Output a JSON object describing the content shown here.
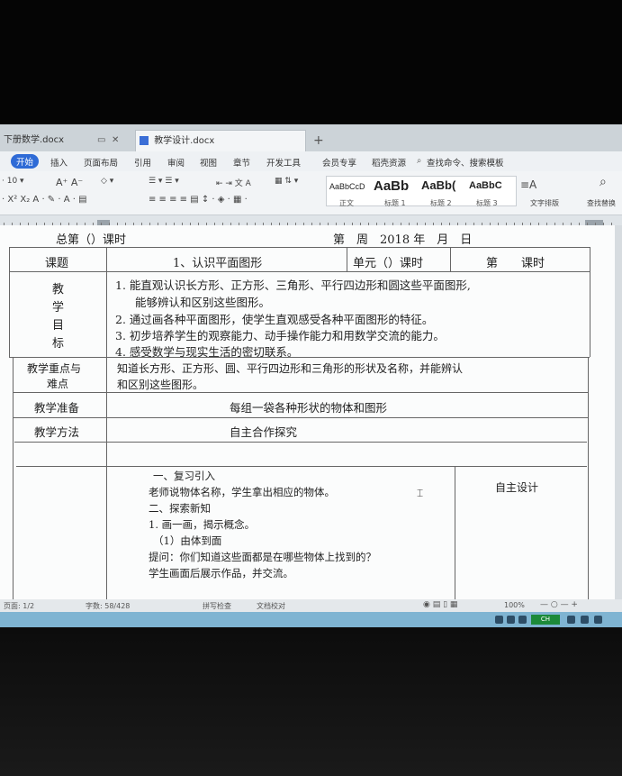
{
  "tabs": {
    "doc1": "下册数学.docx",
    "doc2": "教学设计.docx",
    "add": "+"
  },
  "menu": {
    "start": "开始",
    "insert": "插入",
    "layout": "页面布局",
    "reference": "引用",
    "review": "审阅",
    "view": "视图",
    "section": "章节",
    "dev": "开发工具",
    "vip": "会员专享",
    "resources": "稻壳资源",
    "search": "查找命令、搜索模板"
  },
  "ribbon": {
    "font_size": "10",
    "style1_sample": "AaBbCcD",
    "style1_label": "正文",
    "style2_sample": "AaBb",
    "style2_label": "标题 1",
    "style3_sample": "AaBb(",
    "style3_label": "标题 2",
    "style4_sample": "AaBbC",
    "style4_label": "标题 3",
    "text_layout": "文字排版",
    "find_replace": "查找替换"
  },
  "doc": {
    "header_left": "总第（）课时",
    "header_right": "第　周　2018 年　月　日",
    "row1": {
      "label": "课题",
      "title": "1、认识平面图形",
      "unit": "单元（）课时",
      "period": "第　　课时"
    },
    "goals_label": "教\n学\n目\n标",
    "goals": [
      "1. 能直观认识长方形、正方形、三角形、平行四边形和圆这些平面图形,",
      "能够辨认和区别这些图形。",
      "2. 通过画各种平面图形，使学生直观感受各种平面图形的特征。",
      "3. 初步培养学生的观察能力、动手操作能力和用数学交流的能力。",
      "4. 感受数学与现实生活的密切联系。"
    ],
    "key_label_1": "教学重点与",
    "key_label_2": "难点",
    "key_text_1": "知道长方形、正方形、圆、平行四边形和三角形的形状及名称，并能辨认",
    "key_text_2": "和区别这些图形。",
    "prep_label": "教学准备",
    "prep_text": "每组一袋各种形状的物体和图形",
    "method_label": "教学方法",
    "method_text": "自主合作探究",
    "process": [
      "一、复习引入",
      "老师说物体名称，学生拿出相应的物体。",
      "二、探索新知",
      "1. 画一画，揭示概念。",
      "（1）由体到面",
      "提问：你们知道这些面都是在哪些物体上找到的？",
      "学生画面后展示作品，并交流。"
    ],
    "design_label": "自主设计"
  },
  "status": {
    "page": "页面: 1/2",
    "words": "字数: 58/428",
    "spell": "拼写检查",
    "doc_check": "文档校对",
    "zoom": "100%"
  },
  "taskbar": {
    "badge": "CH"
  }
}
